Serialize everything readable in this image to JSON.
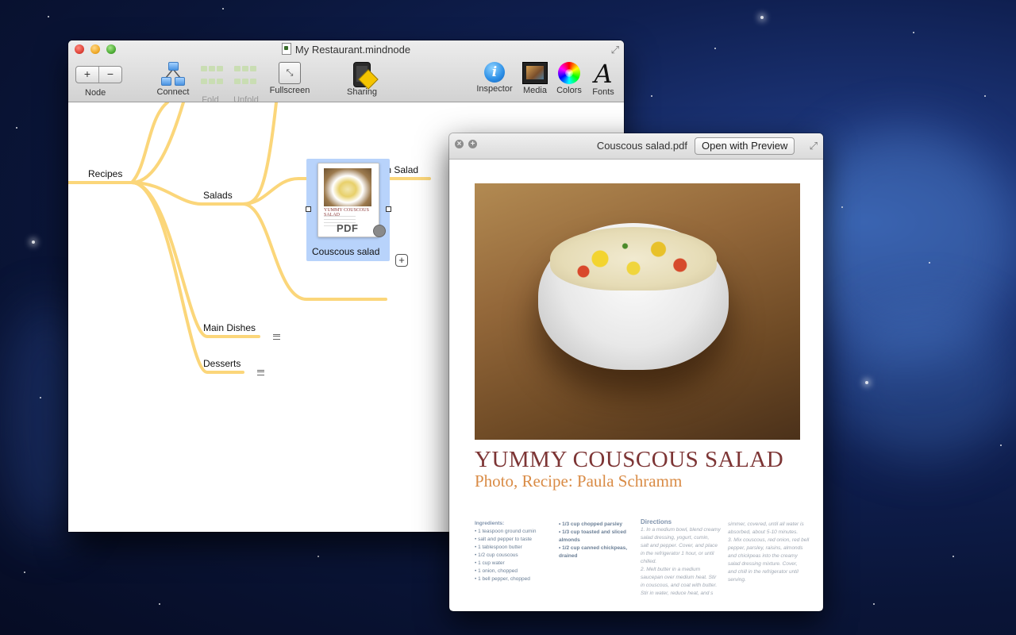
{
  "main_window": {
    "title": "My Restaurant.mindnode",
    "toolbar": {
      "node": {
        "plus": "+",
        "minus": "−",
        "label": "Node"
      },
      "connect": "Connect",
      "fold": "Fold",
      "unfold": "Unfold",
      "fullscreen": "Fullscreen",
      "sharing": "Sharing",
      "inspector": "Inspector",
      "media": "Media",
      "colors": "Colors",
      "fonts": "Fonts"
    },
    "mindmap": {
      "root": "Recipes",
      "salads": "Salads",
      "cranberry": "Cranberry Spinach Salad",
      "couscous": "Couscous salad",
      "pdf_badge": "PDF",
      "main_dishes": "Main Dishes",
      "desserts": "Desserts",
      "add": "+"
    }
  },
  "quicklook": {
    "filename": "Couscous salad.pdf",
    "open_button": "Open with Preview",
    "recipe_title": "YUMMY COUSCOUS SALAD",
    "recipe_subtitle": "Photo, Recipe: Paula Schramm",
    "ingredients_heading": "Ingredients:",
    "ingredients_1": [
      "• 1 teaspoon ground cumin",
      "• salt and pepper to taste",
      "• 1 tablespoon butter",
      "• 1/2 cup couscous",
      "• 1 cup water",
      "• 1 onion, chopped",
      "• 1 bell pepper, chopped"
    ],
    "ingredients_2": [
      "• 1/3 cup chopped parsley",
      "• 1/3 cup toasted and sliced",
      "  almonds",
      "• 1/2 cup canned chickpeas,",
      "  drained"
    ],
    "directions_heading": "Directions",
    "directions_1": [
      "1. In a medium bowl, blend creamy",
      "   salad dressing, yogurt, cumin,",
      "   salt and pepper. Cover, and place",
      "   in the refrigerator 1 hour, or until",
      "   chilled.",
      "2. Melt butter in a medium",
      "   saucepan over medium heat. Stir",
      "   in couscous, and coat with butter.",
      "   Stir in water, reduce heat, and s"
    ],
    "directions_2": [
      "simmer, covered, until all water is",
      "absorbed, about 5-10 minutes.",
      "3. Mix couscous, red onion, red bell",
      "   pepper, parsley, raisins, almonds",
      "   and chickpeas into the creamy",
      "   salad dressing mixture. Cover,",
      "   and chill in the refrigerator until",
      "   serving."
    ]
  }
}
